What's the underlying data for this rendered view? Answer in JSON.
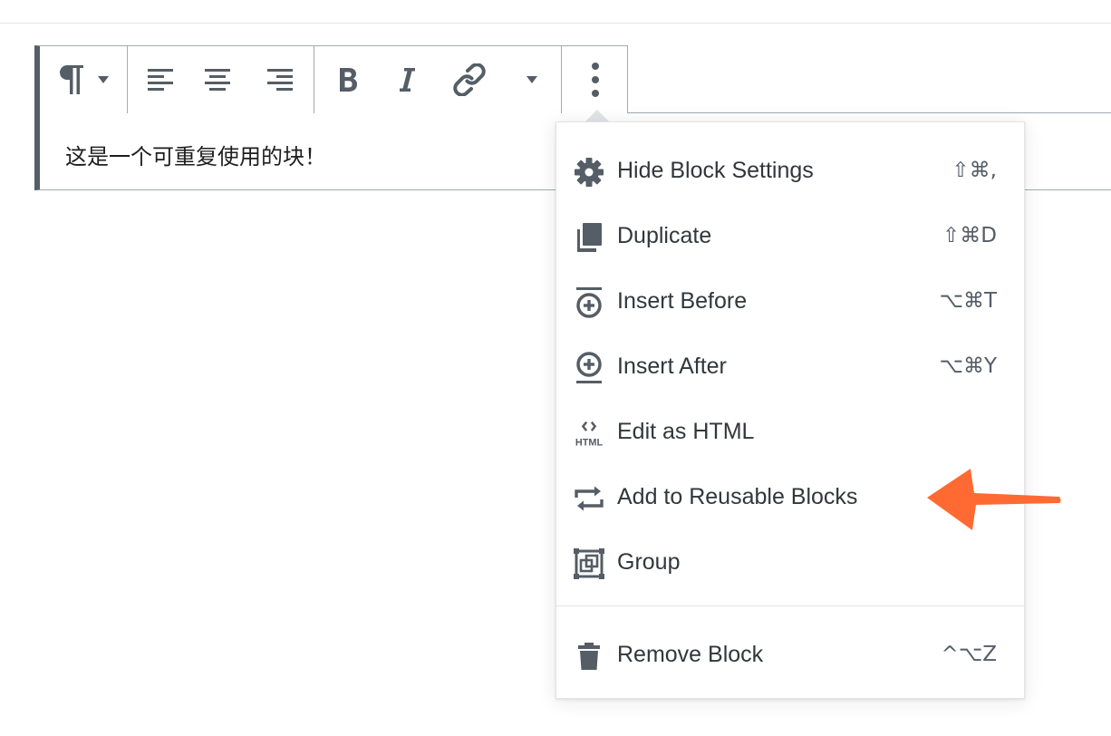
{
  "block": {
    "text": "这是一个可重复使用的块！"
  },
  "toolbar": {
    "buttons": [
      {
        "name": "paragraph",
        "icon": "paragraph-icon",
        "has_dropdown": true
      },
      {
        "name": "align-left",
        "icon": "align-left-icon"
      },
      {
        "name": "align-center",
        "icon": "align-center-icon"
      },
      {
        "name": "align-right",
        "icon": "align-right-icon"
      },
      {
        "name": "bold",
        "icon": "bold-icon"
      },
      {
        "name": "italic",
        "icon": "italic-icon"
      },
      {
        "name": "link",
        "icon": "link-icon"
      },
      {
        "name": "more-rich-text",
        "icon": "chevron-down-icon"
      },
      {
        "name": "more-options",
        "icon": "vertical-ellipsis-icon"
      }
    ]
  },
  "menu": {
    "items": [
      {
        "label": "Hide Block Settings",
        "shortcut": "⇧⌘,",
        "icon": "gear-icon"
      },
      {
        "label": "Duplicate",
        "shortcut": "⇧⌘D",
        "icon": "duplicate-icon"
      },
      {
        "label": "Insert Before",
        "shortcut": "⌥⌘T",
        "icon": "insert-before-icon"
      },
      {
        "label": "Insert After",
        "shortcut": "⌥⌘Y",
        "icon": "insert-after-icon"
      },
      {
        "label": "Edit as HTML",
        "shortcut": "",
        "icon": "html-icon",
        "icon_text": "HTML"
      },
      {
        "label": "Add to Reusable Blocks",
        "shortcut": "",
        "icon": "reusable-block-icon"
      },
      {
        "label": "Group",
        "shortcut": "",
        "icon": "group-icon"
      }
    ],
    "remove": {
      "label": "Remove Block",
      "shortcut": "^⌥Z",
      "icon": "trash-icon"
    }
  },
  "colors": {
    "icon": "#555d66",
    "border": "#a2aab2",
    "text": "#32373c",
    "arrow": "#ff6a33"
  }
}
